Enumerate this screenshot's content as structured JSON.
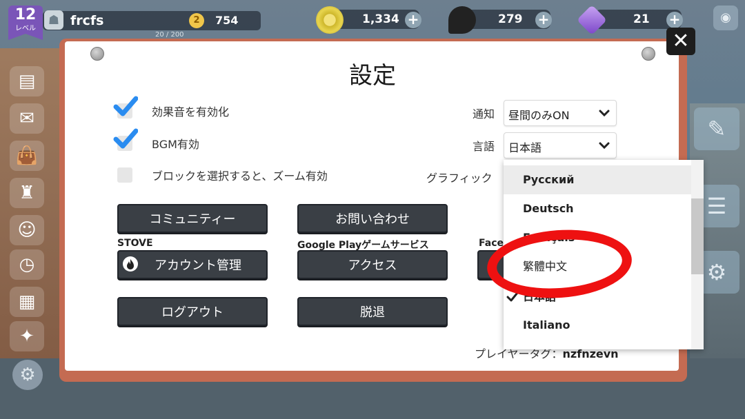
{
  "hud": {
    "level_number": "12",
    "level_label": "レベル",
    "player_name": "frcfs",
    "xp_icon_glyph": "2",
    "xp_value": "754",
    "xp_progress": "20 / 200",
    "coins": "1,334",
    "oil": "279",
    "gems": "21"
  },
  "dialog": {
    "title": "設定",
    "sound_effects_label": "効果音を有効化",
    "sound_effects_checked": true,
    "bgm_label": "BGM有効",
    "bgm_checked": true,
    "zoom_label": "ブロックを選択すると、ズーム有効",
    "zoom_checked": false,
    "notification_label": "通知",
    "notification_value": "昼間のみON",
    "language_label": "言語",
    "language_value": "日本語",
    "graphics_label": "グラフィック",
    "community_button": "コミュニティー",
    "contact_button": "お問い合わせ",
    "stove_label": "STOVE",
    "account_button": "アカウント管理",
    "google_label": "Google Playゲームサービス",
    "access_button": "アクセス",
    "facebook_label": "Face",
    "logout_button": "ログアウト",
    "withdraw_button": "脱退",
    "player_tag_label": "プレイヤータグ：",
    "player_tag_value": "nzfnzevn"
  },
  "language_dropdown": {
    "items": [
      {
        "label": "Русский",
        "highlighted": true,
        "selected": false
      },
      {
        "label": "Deutsch",
        "highlighted": false,
        "selected": false
      },
      {
        "label": "Français",
        "highlighted": false,
        "selected": false
      },
      {
        "label": "繁體中文",
        "highlighted": false,
        "selected": false
      },
      {
        "label": "日本語",
        "highlighted": false,
        "selected": true
      },
      {
        "label": "Italiano",
        "highlighted": false,
        "selected": false
      }
    ]
  },
  "icons": {
    "close": "close-icon",
    "chevron": "chevron-down-icon",
    "check": "checkmark-icon",
    "fire": "stove-flame-icon"
  },
  "colors": {
    "accent_check": "#2a8cf0",
    "button_bg": "#3a3f45",
    "dialog_frame": "#c46b52",
    "annotation": "#ee1111"
  }
}
